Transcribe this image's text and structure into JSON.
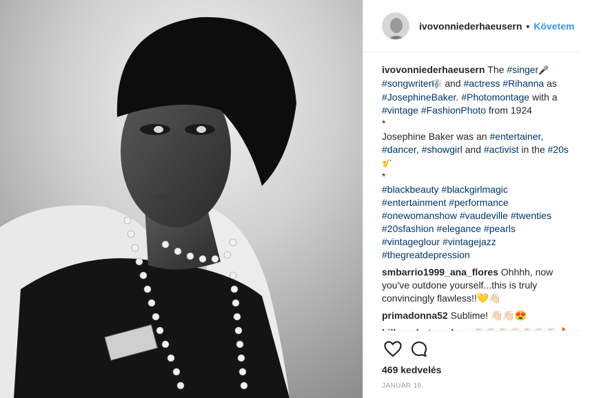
{
  "author": {
    "username": "ivovonniederhaeusern",
    "separator": "•",
    "follow_label": "Követem"
  },
  "caption": {
    "username": "ivovonniederhaeusern",
    "lines": [
      [
        {
          "t": "The "
        },
        {
          "t": "#singer",
          "tag": true
        },
        {
          "t": "🎤",
          "emoji": true
        }
      ],
      [
        {
          "t": "#songwriter",
          "tag": true
        },
        {
          "t": "🎼",
          "emoji": true
        },
        {
          "t": " and "
        },
        {
          "t": "#actress",
          "tag": true
        },
        {
          "t": " "
        },
        {
          "t": "#Rihanna",
          "tag": true
        },
        {
          "t": " as"
        }
      ],
      [
        {
          "t": "#JosephineBaker",
          "tag": true
        },
        {
          "t": ". "
        },
        {
          "t": "#Photomontage",
          "tag": true
        },
        {
          "t": " with a"
        }
      ],
      [
        {
          "t": "#vintage",
          "tag": true
        },
        {
          "t": " "
        },
        {
          "t": "#FashionPhoto",
          "tag": true
        },
        {
          "t": " from 1924"
        }
      ],
      [
        {
          "t": "*"
        }
      ],
      [
        {
          "t": "Josephine Baker was an "
        },
        {
          "t": "#entertainer",
          "tag": true
        },
        {
          "t": ","
        }
      ],
      [
        {
          "t": "#dancer",
          "tag": true
        },
        {
          "t": ", "
        },
        {
          "t": "#showgirl",
          "tag": true
        },
        {
          "t": " and "
        },
        {
          "t": "#activist",
          "tag": true
        },
        {
          "t": " in the "
        },
        {
          "t": "#20s",
          "tag": true
        }
      ],
      [
        {
          "t": "🎷",
          "emoji": true
        }
      ],
      [
        {
          "t": "*"
        }
      ],
      [
        {
          "t": "#blackbeauty",
          "tag": true
        },
        {
          "t": " "
        },
        {
          "t": "#blackgirlmagic",
          "tag": true
        }
      ],
      [
        {
          "t": "#entertainment",
          "tag": true
        },
        {
          "t": " "
        },
        {
          "t": "#performance",
          "tag": true
        }
      ],
      [
        {
          "t": "#onewomanshow",
          "tag": true
        },
        {
          "t": " "
        },
        {
          "t": "#vaudeville",
          "tag": true
        },
        {
          "t": " "
        },
        {
          "t": "#twenties",
          "tag": true
        }
      ],
      [
        {
          "t": "#20sfashion",
          "tag": true
        },
        {
          "t": " "
        },
        {
          "t": "#elegance",
          "tag": true
        },
        {
          "t": " "
        },
        {
          "t": "#pearls",
          "tag": true
        }
      ],
      [
        {
          "t": "#vintageglour",
          "tag": true
        },
        {
          "t": " "
        },
        {
          "t": "#vintagejazz",
          "tag": true
        }
      ],
      [
        {
          "t": "#thegreatdepression",
          "tag": true
        }
      ]
    ]
  },
  "comments": [
    {
      "username": "smbarrio1999_ana_flores",
      "lines": [
        "Ohhhh, now",
        "you've outdone yourself...this is truly",
        "convincingly flawless!!💛👋🏻"
      ]
    },
    {
      "username": "primadonna52",
      "lines": [
        "Sublime! 👋🏻👋🏻😍"
      ]
    },
    {
      "username": "bilbaophotocadeau",
      "lines": [
        "👋🏻👋🏻👋🏻👋🏻👋🏻👋🏻👋🏻🔥🔥🔥"
      ]
    }
  ],
  "actions": {
    "like_icon": "heart-icon",
    "comment_icon": "comment-icon"
  },
  "likes_text": "469 kedvelés",
  "date_text": "JANUÁR 16.",
  "colors": {
    "link": "#003569",
    "follow": "#3897f0",
    "muted": "#999999",
    "text": "#262626"
  }
}
